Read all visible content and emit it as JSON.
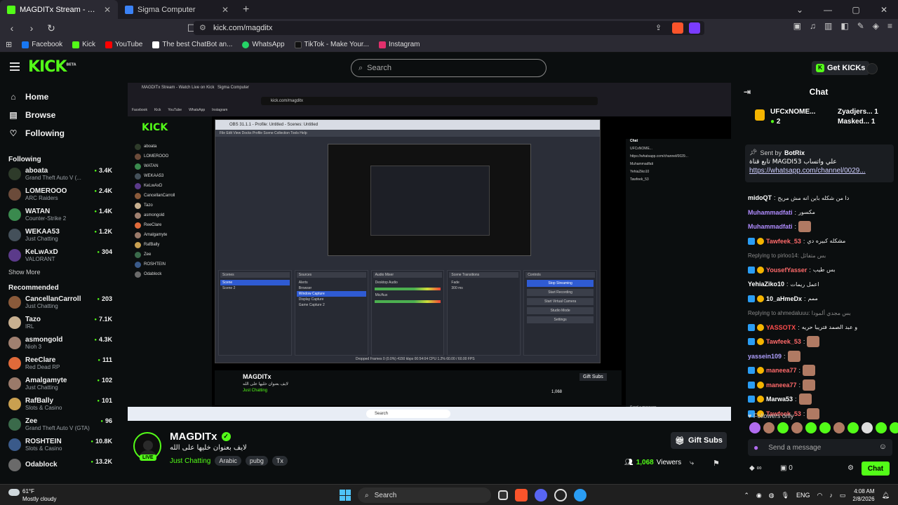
{
  "browser": {
    "tabs": [
      {
        "title": "MAGDITx Stream - Watch Live on Kick",
        "active": true
      },
      {
        "title": "Sigma Computer",
        "active": false
      }
    ],
    "url": "kick.com/magditx",
    "bookmarks": [
      "Facebook",
      "Kick",
      "YouTube",
      "The best ChatBot an...",
      "WhatsApp",
      "TikTok - Make Your...",
      "Instagram"
    ]
  },
  "header": {
    "logo": "KICK",
    "logo_sup": "BETA",
    "search_placeholder": "Search",
    "get_kicks": "Get KICKs"
  },
  "sidebar": {
    "nav": [
      {
        "label": "Home",
        "icon": "home-icon"
      },
      {
        "label": "Browse",
        "icon": "browse-icon"
      },
      {
        "label": "Following",
        "icon": "heart-icon"
      }
    ],
    "following_title": "Following",
    "following": [
      {
        "name": "aboata",
        "game": "Grand Theft Auto V (...",
        "viewers": "3.4K",
        "color": "#2e3b2a"
      },
      {
        "name": "LOMEROOO",
        "game": "ARC Raiders",
        "viewers": "2.4K",
        "color": "#6b4b3a"
      },
      {
        "name": "WATAN",
        "game": "Counter-Strike 2",
        "viewers": "1.4K",
        "color": "#3a8a4e"
      },
      {
        "name": "WEKAA53",
        "game": "Just Chatting",
        "viewers": "1.2K",
        "color": "#44505a"
      },
      {
        "name": "KeLwAxD",
        "game": "VALORANT",
        "viewers": "304",
        "color": "#5b3a8a"
      }
    ],
    "show_more": "Show More",
    "recommended_title": "Recommended",
    "recommended": [
      {
        "name": "CancellanCarroll",
        "game": "Just Chatting",
        "viewers": "203",
        "color": "#8a5a3a"
      },
      {
        "name": "Tazo",
        "game": "IRL",
        "viewers": "7.1K",
        "color": "#c8b090"
      },
      {
        "name": "asmongold",
        "game": "Nioh 3",
        "viewers": "4.3K",
        "color": "#a08070"
      },
      {
        "name": "ReeClare",
        "game": "Red Dead RP",
        "viewers": "111",
        "color": "#e06a3a"
      },
      {
        "name": "Amalgamyte",
        "game": "Just Chatting",
        "viewers": "102",
        "color": "#9a7a6a"
      },
      {
        "name": "RafBally",
        "game": "Slots & Casino",
        "viewers": "101",
        "color": "#c9a050"
      },
      {
        "name": "Zee",
        "game": "Grand Theft Auto V (GTA)",
        "viewers": "96",
        "color": "#3a6a4a"
      },
      {
        "name": "ROSHTEIN",
        "game": "Slots & Casino",
        "viewers": "10.8K",
        "color": "#3a5a8a"
      },
      {
        "name": "Odablock",
        "game": "",
        "viewers": "13.2K",
        "color": "#6a6a6a"
      }
    ]
  },
  "stream": {
    "streamer": "MAGDITx",
    "title": "لايف بعنوان خليها على الله",
    "category": "Just Chatting",
    "tags": [
      "Arabic",
      "pubg",
      "Tx"
    ],
    "live_label": "LIVE",
    "viewers": "1,068",
    "viewers_label": "Viewers",
    "gift_subs": "Gift Subs"
  },
  "video_inner": {
    "obs_title": "OBS 31.1.1 - Profile: Untitled - Scenes: Untitled",
    "obs_menu": "File  Edit  View  Docks  Profile  Scene Collection  Tools  Help",
    "docks": [
      "Scenes",
      "Sources",
      "Audio Mixer",
      "Scene Transitions",
      "Controls"
    ],
    "scenes": [
      "Scene",
      "Scene 2"
    ],
    "sources": [
      "Alerts",
      "Browser",
      "Window Capture",
      "Display Capture",
      "Game Capture 2"
    ],
    "mixer": [
      "Desktop Audio",
      "Mic/Aux"
    ],
    "transition": "Fade",
    "duration": "300 ms",
    "controls": [
      "Stop Streaming",
      "Start Recording",
      "Start Virtual Camera",
      "Studio Mode",
      "Settings"
    ],
    "taskbar_search": "Search",
    "status": "Dropped Frames 0 (0.0%)  4150 kbps  00:54:04  CPU 1.2%  60.00 / 60.00 FPS"
  },
  "chat": {
    "title": "Chat",
    "leaderboard": [
      {
        "name": "UFCxNOME...",
        "count": "2"
      },
      {
        "name": "Zyadjers...",
        "count": "1"
      },
      {
        "name": "Masked...",
        "count": "1"
      }
    ],
    "pinned": {
      "sent_by_label": "Sent by",
      "sender": "BotRix",
      "message": "علي واتساب MAGDI53 تابع قناة",
      "link": "https://whatsapp.com/channel/0029..."
    },
    "messages": [
      {
        "user": "midoQT",
        "color": "#ffffff",
        "text": "دا من شكله باين انه مش مريح"
      },
      {
        "user": "Muhammadfati",
        "color": "#b08cff",
        "text": "مكسور"
      },
      {
        "user": "Muhammadfati",
        "color": "#b08cff",
        "text": "",
        "emote": true
      },
      {
        "user": "Tawfeek_53",
        "color": "#ff6a6a",
        "text": "مشكله كبيره دي",
        "badges": true
      },
      {
        "user": "",
        "color": "#888888",
        "text": "Replying to pirloo14: بس متفائل",
        "reply": true
      },
      {
        "user": "YousefYasser",
        "color": "#ff6a6a",
        "text": "بس طيب",
        "badges": true
      },
      {
        "user": "YehiaZiko10",
        "color": "#ffffff",
        "text": "اعمل ريمات"
      },
      {
        "user": "10_aHmeDx",
        "color": "#ffffff",
        "text": "ممم",
        "badges": true
      },
      {
        "user": "",
        "color": "#888888",
        "text": "Replying to ahmedaluuu: بس مجدي ألمودا",
        "reply": true
      },
      {
        "user": "YASSOTX",
        "color": "#ff4d4d",
        "text": "و عبد الصمد فتريبا حريه",
        "badges": true
      },
      {
        "user": "Tawfeek_53",
        "color": "#ff6a6a",
        "text": "",
        "emote": true,
        "badges": true
      },
      {
        "user": "yassein109",
        "color": "#b0a0ff",
        "text": "",
        "emote": true
      },
      {
        "user": "maneea77",
        "color": "#ff6a6a",
        "text": "",
        "emote": true,
        "badges": true
      },
      {
        "user": "maneea77",
        "color": "#ff6a6a",
        "text": "",
        "emote": true,
        "badges": true
      },
      {
        "user": "Marwa53",
        "color": "#ffffff",
        "text": "",
        "emote": true,
        "badges": true
      },
      {
        "user": "Tawfeek_53",
        "color": "#ff6a6a",
        "text": "",
        "emote": true,
        "badges": true
      }
    ],
    "followers_only": "Followers only",
    "send_placeholder": "Send a message",
    "points": "∞",
    "gift_count": "0",
    "chat_button": "Chat"
  },
  "taskbar": {
    "temp": "61°F",
    "weather": "Mostly cloudy",
    "search": "Search",
    "lang": "ENG",
    "time": "4:08 AM",
    "date": "2/8/2026"
  },
  "colors": {
    "accent": "#53fc18",
    "background": "#0b0e0f"
  }
}
